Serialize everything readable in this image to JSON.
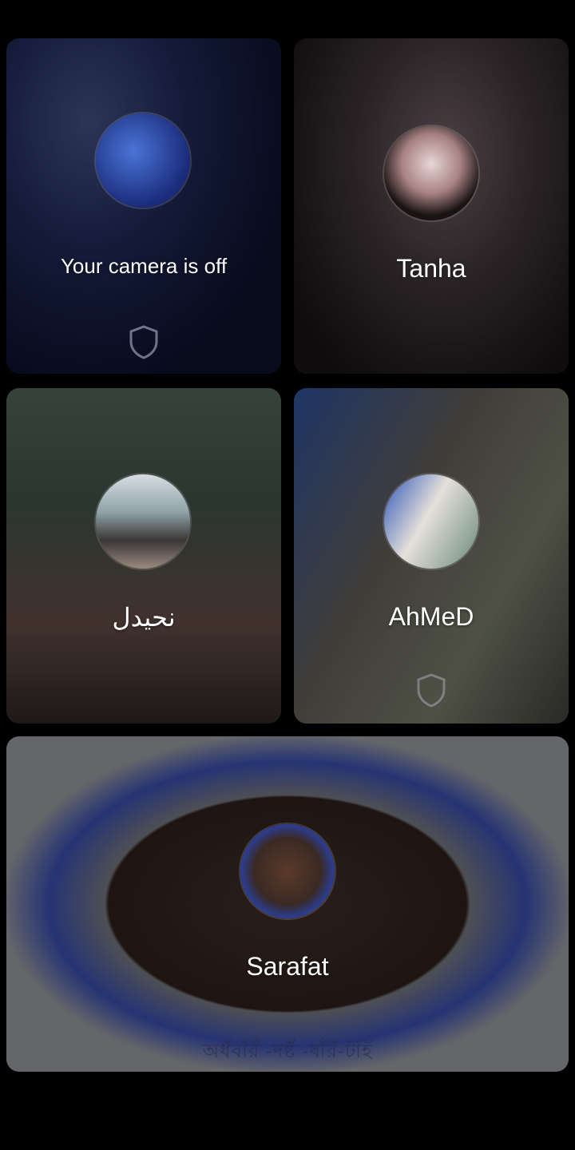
{
  "tiles": [
    {
      "id": "self",
      "label": "Your camera is off",
      "has_shield": true
    },
    {
      "id": "tanha",
      "label": "Tanha",
      "has_shield": false
    },
    {
      "id": "nahid",
      "label": "نحيدل",
      "has_shield": false
    },
    {
      "id": "ahmed",
      "label": "AhMeD",
      "has_shield": true
    },
    {
      "id": "sarafat",
      "label": "Sarafat",
      "has_shield": false,
      "footer": "অধঁবাঁরঁ -দষ্টঁ -বাঁরঁ-টাঁহঁ"
    }
  ],
  "icons": {
    "shield": "shield-icon"
  },
  "colors": {
    "background": "#000000",
    "label": "#ffffff"
  }
}
